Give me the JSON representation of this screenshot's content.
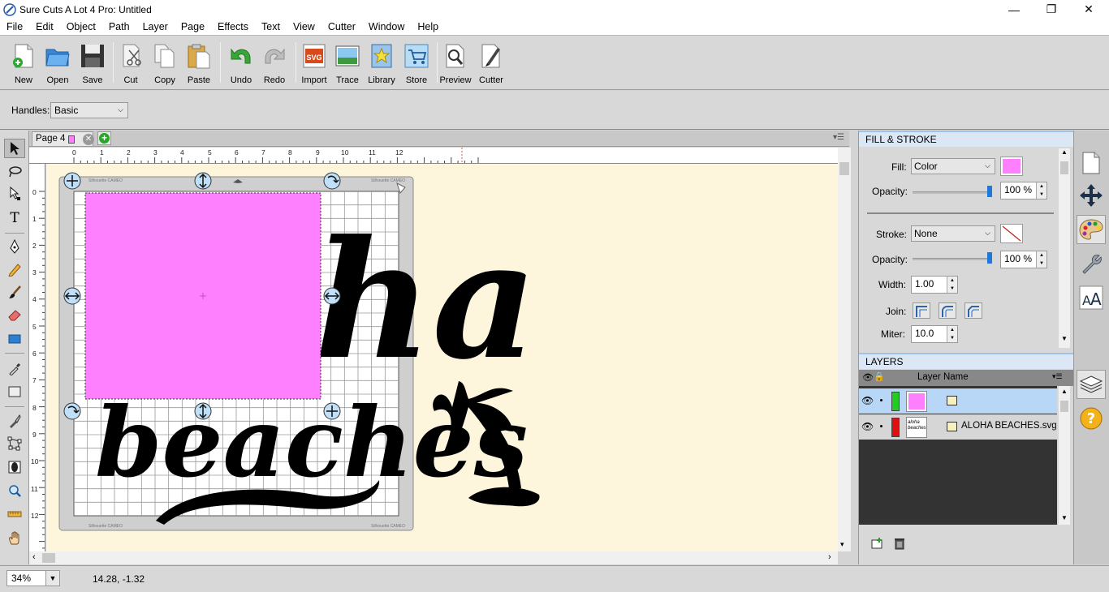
{
  "app": {
    "title": "Sure Cuts A Lot 4 Pro: Untitled",
    "window_controls": {
      "minimize": "—",
      "maximize": "❐",
      "close": "✕"
    }
  },
  "menu": [
    "File",
    "Edit",
    "Object",
    "Path",
    "Layer",
    "Page",
    "Effects",
    "Text",
    "View",
    "Cutter",
    "Window",
    "Help"
  ],
  "toolbar": {
    "new": "New",
    "open": "Open",
    "save": "Save",
    "cut": "Cut",
    "copy": "Copy",
    "paste": "Paste",
    "undo": "Undo",
    "redo": "Redo",
    "import": "Import",
    "trace": "Trace",
    "library": "Library",
    "store": "Store",
    "preview": "Preview",
    "cutter": "Cutter"
  },
  "handles": {
    "label": "Handles:",
    "value": "Basic"
  },
  "page_tab": {
    "label": "Page 4",
    "color": "#ff80ff"
  },
  "rulers": {
    "h": [
      "0",
      "1",
      "2",
      "3",
      "4",
      "5",
      "6",
      "7",
      "8",
      "9",
      "10",
      "11",
      "12"
    ],
    "v": [
      "0",
      "1",
      "2",
      "3",
      "4",
      "5",
      "6",
      "7",
      "8",
      "9",
      "10",
      "11",
      "12"
    ]
  },
  "mat": {
    "brand_text": "Silhouette CAMEO"
  },
  "artwork": {
    "title_text": "ha",
    "subtitle_text": "beaches",
    "rect_color": "#ff80ff"
  },
  "status": {
    "zoom": "34%",
    "coords": "14.28, -1.32"
  },
  "fill_stroke": {
    "header": "FILL & STROKE",
    "fill_label": "Fill:",
    "fill_type": "Color",
    "fill_color": "#ff80ff",
    "fill_opacity_label": "Opacity:",
    "fill_opacity": "100 %",
    "stroke_label": "Stroke:",
    "stroke_type": "None",
    "stroke_opacity_label": "Opacity:",
    "stroke_opacity": "100 %",
    "width_label": "Width:",
    "width": "1.00",
    "join_label": "Join:",
    "miter_label": "Miter:",
    "miter": "10.0"
  },
  "layers": {
    "header": "LAYERS",
    "column": "Layer Name",
    "rows": [
      {
        "name": "",
        "color": "#22cc22",
        "thumb": "pink"
      },
      {
        "name": "ALOHA BEACHES.svg",
        "color": "#dd1111",
        "thumb": "text",
        "thumb_text": "aloha beaches"
      }
    ]
  }
}
